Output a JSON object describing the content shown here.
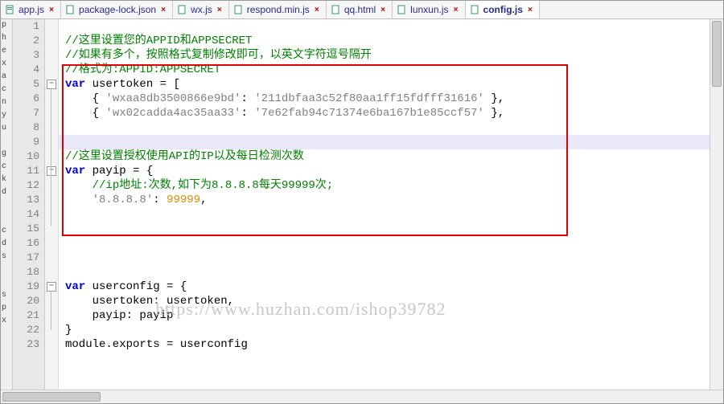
{
  "tabs": [
    {
      "label": "app.js",
      "active": false
    },
    {
      "label": "package-lock.json",
      "active": false
    },
    {
      "label": "wx.js",
      "active": false
    },
    {
      "label": "respond.min.js",
      "active": false
    },
    {
      "label": "qq.html",
      "active": false
    },
    {
      "label": "lunxun.js",
      "active": false
    },
    {
      "label": "config.js",
      "active": true
    }
  ],
  "left_sidebar_hints": [
    "p",
    "h",
    "e",
    "x",
    "a",
    "c",
    "n",
    "y",
    "u",
    "",
    "g",
    "c",
    "k",
    "d",
    "",
    "",
    "c",
    "d",
    "s",
    "",
    "",
    "s",
    "p",
    "x"
  ],
  "code": {
    "l1": {
      "comment": "//这里设置您的APPID和APPSECRET"
    },
    "l2": {
      "comment": "//如果有多个，按照格式复制修改即可，以英文字符逗号隔开"
    },
    "l3": {
      "comment": "//格式为:APPID:APPSECRET"
    },
    "l4": {
      "kw": "var",
      "ident": " usertoken ",
      "punct": "= ["
    },
    "l5": {
      "indent": "    ",
      "p1": "{ ",
      "s1": "'wxaa8db3500866e9bd'",
      "p2": ": ",
      "s2": "'211dbfaa3c52f80aa1ff15fdfff31616'",
      "p3": " },"
    },
    "l6": {
      "indent": "    ",
      "p1": "{ ",
      "s1": "'wx02cadda4ac35aa33'",
      "p2": ": ",
      "s2": "'7e62fab94c71374e6ba167b1e85ccf57'",
      "p3": " },"
    },
    "l9": {
      "comment": "//这里设置授权使用API的IP以及每日检测次数"
    },
    "l10": {
      "kw": "var",
      "ident": " payip ",
      "punct": "= {"
    },
    "l11": {
      "indent": "    ",
      "comment": "//ip地址:次数,如下为8.8.8.8每天99999次;"
    },
    "l12": {
      "indent": "    ",
      "s1": "'8.8.8.8'",
      "p2": ": ",
      "num": "99999",
      "p3": ","
    },
    "l18": {
      "kw": "var",
      "ident": " userconfig ",
      "punct": "= {"
    },
    "l19": {
      "indent": "    ",
      "ident": "usertoken: usertoken,"
    },
    "l20": {
      "indent": "    ",
      "ident": "payip: payip"
    },
    "l21": {
      "punct": "}"
    },
    "l22": {
      "ident": "module.exports ",
      "punct": "=",
      "ident2": " userconfig"
    }
  },
  "line_numbers": [
    "1",
    "2",
    "3",
    "4",
    "5",
    "6",
    "7",
    "8",
    "9",
    "10",
    "11",
    "12",
    "13",
    "14",
    "15",
    "16",
    "17",
    "18",
    "19",
    "20",
    "21",
    "22",
    "23"
  ],
  "watermark": "https://www.huzhan.com/ishop39782",
  "fold_minus": "−"
}
